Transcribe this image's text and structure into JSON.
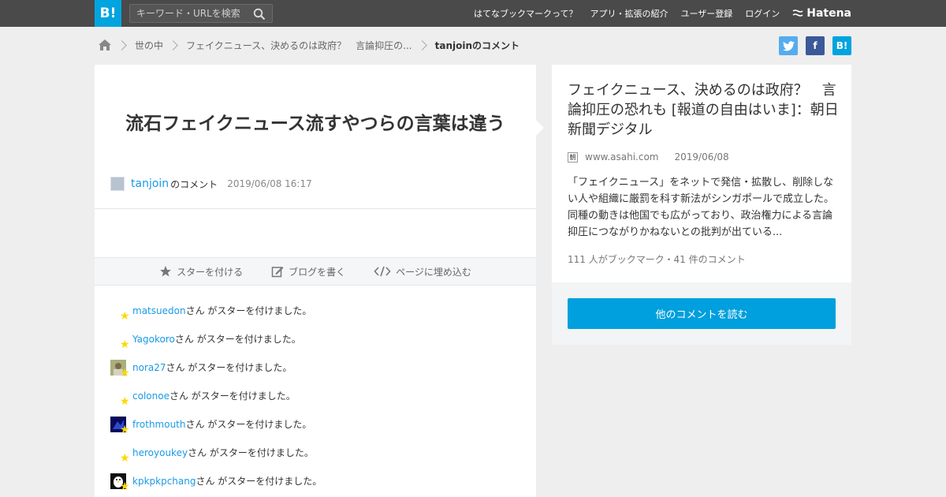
{
  "header": {
    "logo": "B!",
    "search_placeholder": "キーワード・URLを検索",
    "nav": [
      "はてなブックマークって？",
      "アプリ・拡張の紹介",
      "ユーザー登録",
      "ログイン"
    ],
    "brand": "Hatena"
  },
  "breadcrumb": {
    "items": [
      "世の中",
      "フェイクニュース、決めるのは政府？　言論抑圧の...",
      "tanjoinのコメント"
    ]
  },
  "social": {
    "facebook": "f",
    "hatena": "B!"
  },
  "comment": {
    "text": "流石フェイクニュース流すやつらの言葉は違う",
    "author": "tanjoin",
    "author_suffix": "のコメント",
    "date": "2019/06/08 16:17"
  },
  "actions": {
    "star": "スターを付ける",
    "blog": "ブログを書く",
    "embed": "ページに埋め込む"
  },
  "stars": {
    "suffix": "さん がスターを付けました。",
    "users": [
      {
        "name": "matsuedon",
        "avatar": "none"
      },
      {
        "name": "Yagokoro",
        "avatar": "none"
      },
      {
        "name": "nora27",
        "avatar": "photo"
      },
      {
        "name": "colonoe",
        "avatar": "none"
      },
      {
        "name": "frothmouth",
        "avatar": "dark"
      },
      {
        "name": "heroyoukey",
        "avatar": "none"
      },
      {
        "name": "kpkpkpchang",
        "avatar": "penguin"
      }
    ]
  },
  "article": {
    "title": "フェイクニュース、決めるのは政府？　言論抑圧の恐れも [報道の自由はいま]：朝日新聞デジタル",
    "favicon": "朝",
    "domain": "www.asahi.com",
    "date": "2019/06/08",
    "description": "「フェイクニュース」をネットで発信・拡散し、削除しない人や組織に厳罰を科す新法がシンガポールで成立した。同種の動きは他国でも広がっており、政治権力による言論抑圧につながりかねないとの批判が出ている...",
    "stats": "111 人がブックマーク・41 件のコメント"
  },
  "read_more": "他のコメントを読む",
  "colors": {
    "topbar": "#4a4a4a",
    "accent": "#00a4de",
    "link": "#1a9ae6",
    "star": "#ffd700"
  }
}
